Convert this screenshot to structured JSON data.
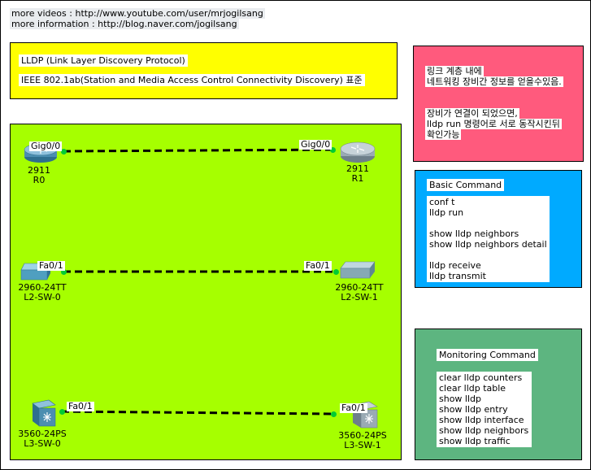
{
  "header": {
    "videos": "more videos : http://www.youtube.com/user/mrjogilsang",
    "info": "more information : http://blog.naver.com/jogilsang"
  },
  "lldp_box": {
    "title": "LLDP (Link Layer Discovery Protocol)",
    "standard": "IEEE 802.1ab(Station and Media Access Control Connectivity Discovery) 표준"
  },
  "note_box": {
    "line1": "링크 계층 내에",
    "line2": "네트워킹 장비간 정보를 얻을수있음.",
    "line3": "장비가 연결이 되었으면,",
    "line4": " lldp run 명령어로 서로 동작시킨뒤",
    "line5": "확인가능"
  },
  "basic": {
    "title": "Basic Command",
    "commands": [
      "conf t",
      "lldp run",
      "",
      "show lldp neighbors",
      "show lldp neighbors detail",
      "",
      "lldp receive",
      "lldp transmit"
    ]
  },
  "monitoring": {
    "title": "Monitoring Command",
    "commands": [
      "clear lldp counters",
      "clear lldp table",
      "show lldp",
      "show lldp entry",
      "show lldp interface",
      "show lldp neighbors",
      "show lldp traffic"
    ]
  },
  "devices": {
    "r0": {
      "model": "2911",
      "name": "R0",
      "port": "Gig0/0"
    },
    "r1": {
      "model": "2911",
      "name": "R1",
      "port": "Gig0/0"
    },
    "l2sw0": {
      "model": "2960-24TT",
      "name": "L2-SW-0",
      "port": "Fa0/1"
    },
    "l2sw1": {
      "model": "2960-24TT",
      "name": "L2-SW-1",
      "port": "Fa0/1"
    },
    "l3sw0": {
      "model": "3560-24PS",
      "name": "L3-SW-0",
      "port": "Fa0/1"
    },
    "l3sw1": {
      "model": "3560-24PS",
      "name": "L3-SW-1",
      "port": "Fa0/1"
    }
  },
  "colors": {
    "lldp_box": "#ffff00",
    "network_area": "#a6ff00",
    "note_box": "#ff5a7d",
    "basic_box": "#00aaff",
    "monitoring_box": "#5db580",
    "link_up": "#00cc33"
  }
}
